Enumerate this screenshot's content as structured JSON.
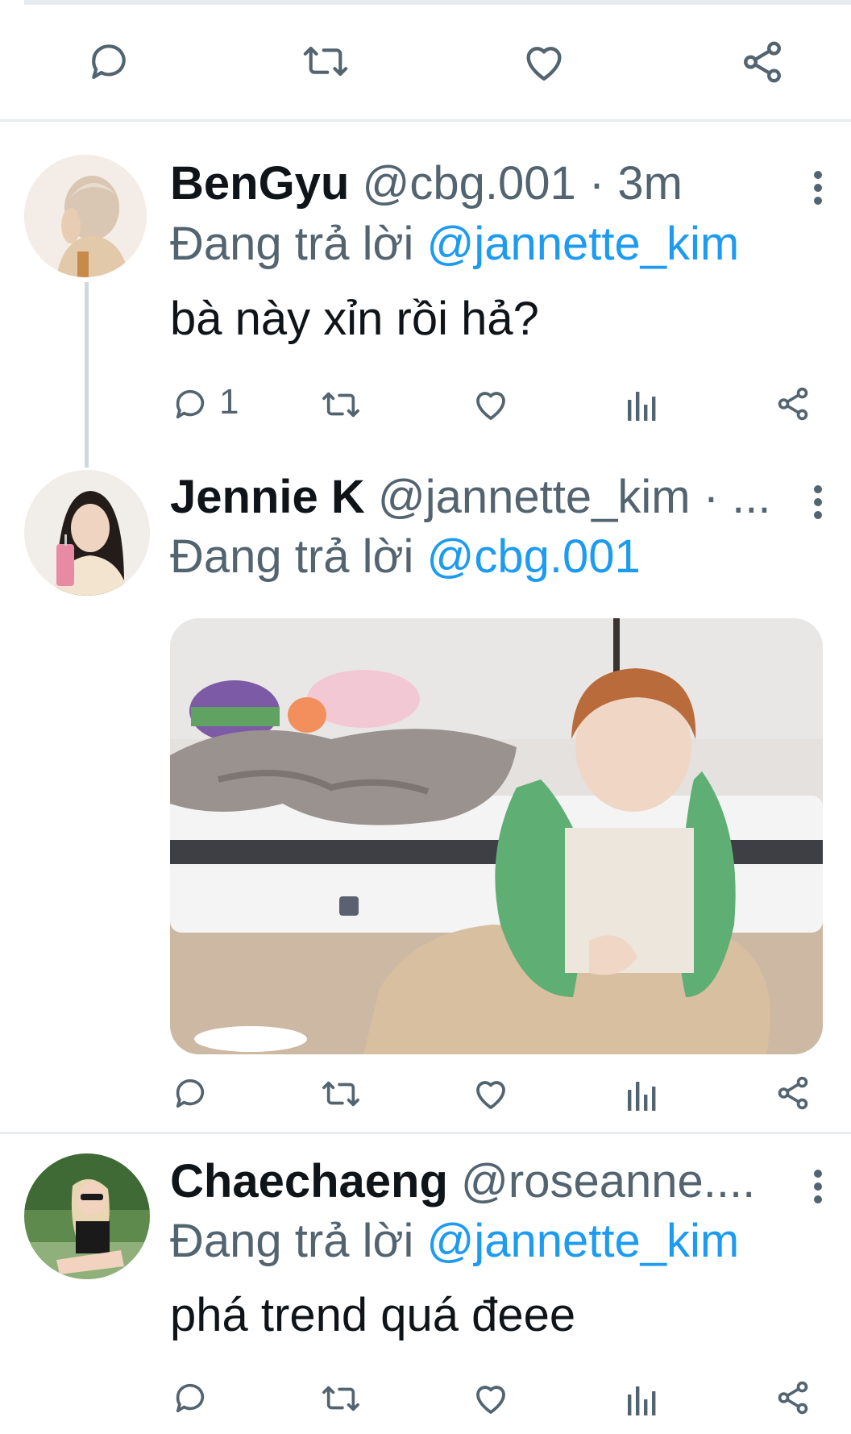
{
  "top_actions": {
    "reply_icon": "reply-icon",
    "retweet_icon": "retweet-icon",
    "like_icon": "heart-icon",
    "share_icon": "share-icon"
  },
  "tweets": [
    {
      "name": "BenGyu",
      "handle": "@cbg.001",
      "time": "· 3m",
      "replying_prefix": "Đang trả lời",
      "replying_to": "@jannette_kim",
      "text": "bà này xỉn rồi hả?",
      "reply_count": "1"
    },
    {
      "name": "Jennie K",
      "handle": "@jannette_kim",
      "time": "· ...",
      "replying_prefix": "Đang trả lời",
      "replying_to": "@cbg.001",
      "has_media": true
    },
    {
      "name": "Chaechaeng",
      "handle": "@roseanne....",
      "replying_prefix": "Đang trả lời",
      "replying_to": "@jannette_kim",
      "text": "phá trend quá đeee"
    }
  ],
  "colors": {
    "accent": "#1d9bf0",
    "muted": "#536471",
    "divider": "#e6ecf0"
  }
}
